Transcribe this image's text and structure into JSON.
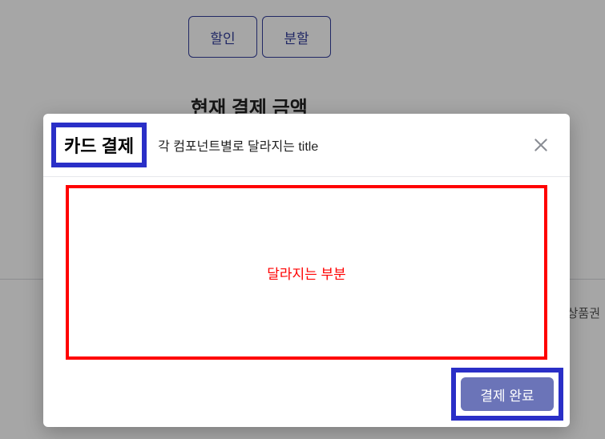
{
  "background": {
    "buttons": {
      "discount": "할인",
      "split": "분할"
    },
    "section_title": "현재 결제 금액",
    "right_partial": "상품권"
  },
  "modal": {
    "title": "카드 결제",
    "subtitle": "각 컴포넌트별로 달라지는 title",
    "body_text": "달라지는 부분",
    "submit_label": "결제 완료"
  },
  "colors": {
    "highlight_border": "#2a2fc7",
    "danger_border": "#ff0000",
    "button_primary_bg": "#6b74b8",
    "outline_button": "#333e9b"
  }
}
